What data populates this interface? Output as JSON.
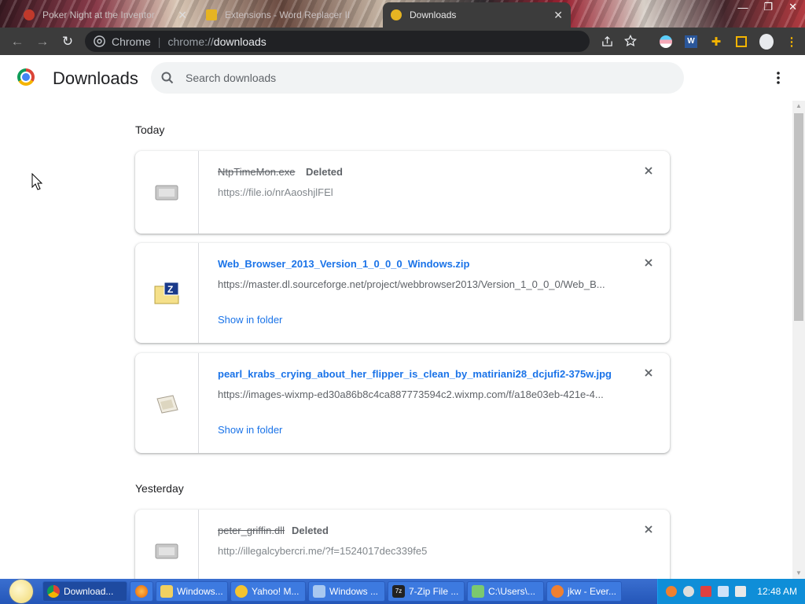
{
  "browser": {
    "tabs": [
      {
        "title": "Poker Night at the Inventor"
      },
      {
        "title": "Extensions - Word Replacer II"
      },
      {
        "title": "Downloads",
        "active": true
      }
    ],
    "site_label": "Chrome",
    "url_scheme": "chrome://",
    "url_path": "downloads"
  },
  "page": {
    "title": "Downloads",
    "search_placeholder": "Search downloads"
  },
  "groups": [
    {
      "date": "Today",
      "items": [
        {
          "filename": "NtpTimeMon.exe",
          "status": "Deleted",
          "url": "https://file.io/nrAaoshjlFEl",
          "deleted": true,
          "file_icon": "generic-file-icon"
        },
        {
          "filename": "Web_Browser_2013_Version_1_0_0_0_Windows.zip",
          "url": "https://master.dl.sourceforge.net/project/webbrowser2013/Version_1_0_0_0/Web_B...",
          "action": "Show in folder",
          "file_icon": "zip-archive-icon"
        },
        {
          "filename": "pearl_krabs_crying_about_her_flipper_is_clean_by_matiriani28_dcjufi2-375w.jpg",
          "url": "https://images-wixmp-ed30a86b8c4ca887773594c2.wixmp.com/f/a18e03eb-421e-4...",
          "action": "Show in folder",
          "file_icon": "image-file-icon"
        }
      ]
    },
    {
      "date": "Yesterday",
      "items": [
        {
          "filename": "peter_griffin.dll",
          "status": "Deleted",
          "url": "http://illegalcybercri.me/?f=1524017dec339fe5",
          "deleted": true,
          "file_icon": "generic-file-icon"
        }
      ]
    }
  ],
  "taskbar": {
    "buttons": [
      "Download...",
      "Windows...",
      "Yahoo! M...",
      "Windows ...",
      "7-Zip File ...",
      "C:\\Users\\...",
      "jkw - Ever..."
    ],
    "clock": "12:48 AM"
  },
  "colors": {
    "link": "#1a73e8",
    "toolbar": "#3c3c3c",
    "taskbar": "#2456b8"
  }
}
